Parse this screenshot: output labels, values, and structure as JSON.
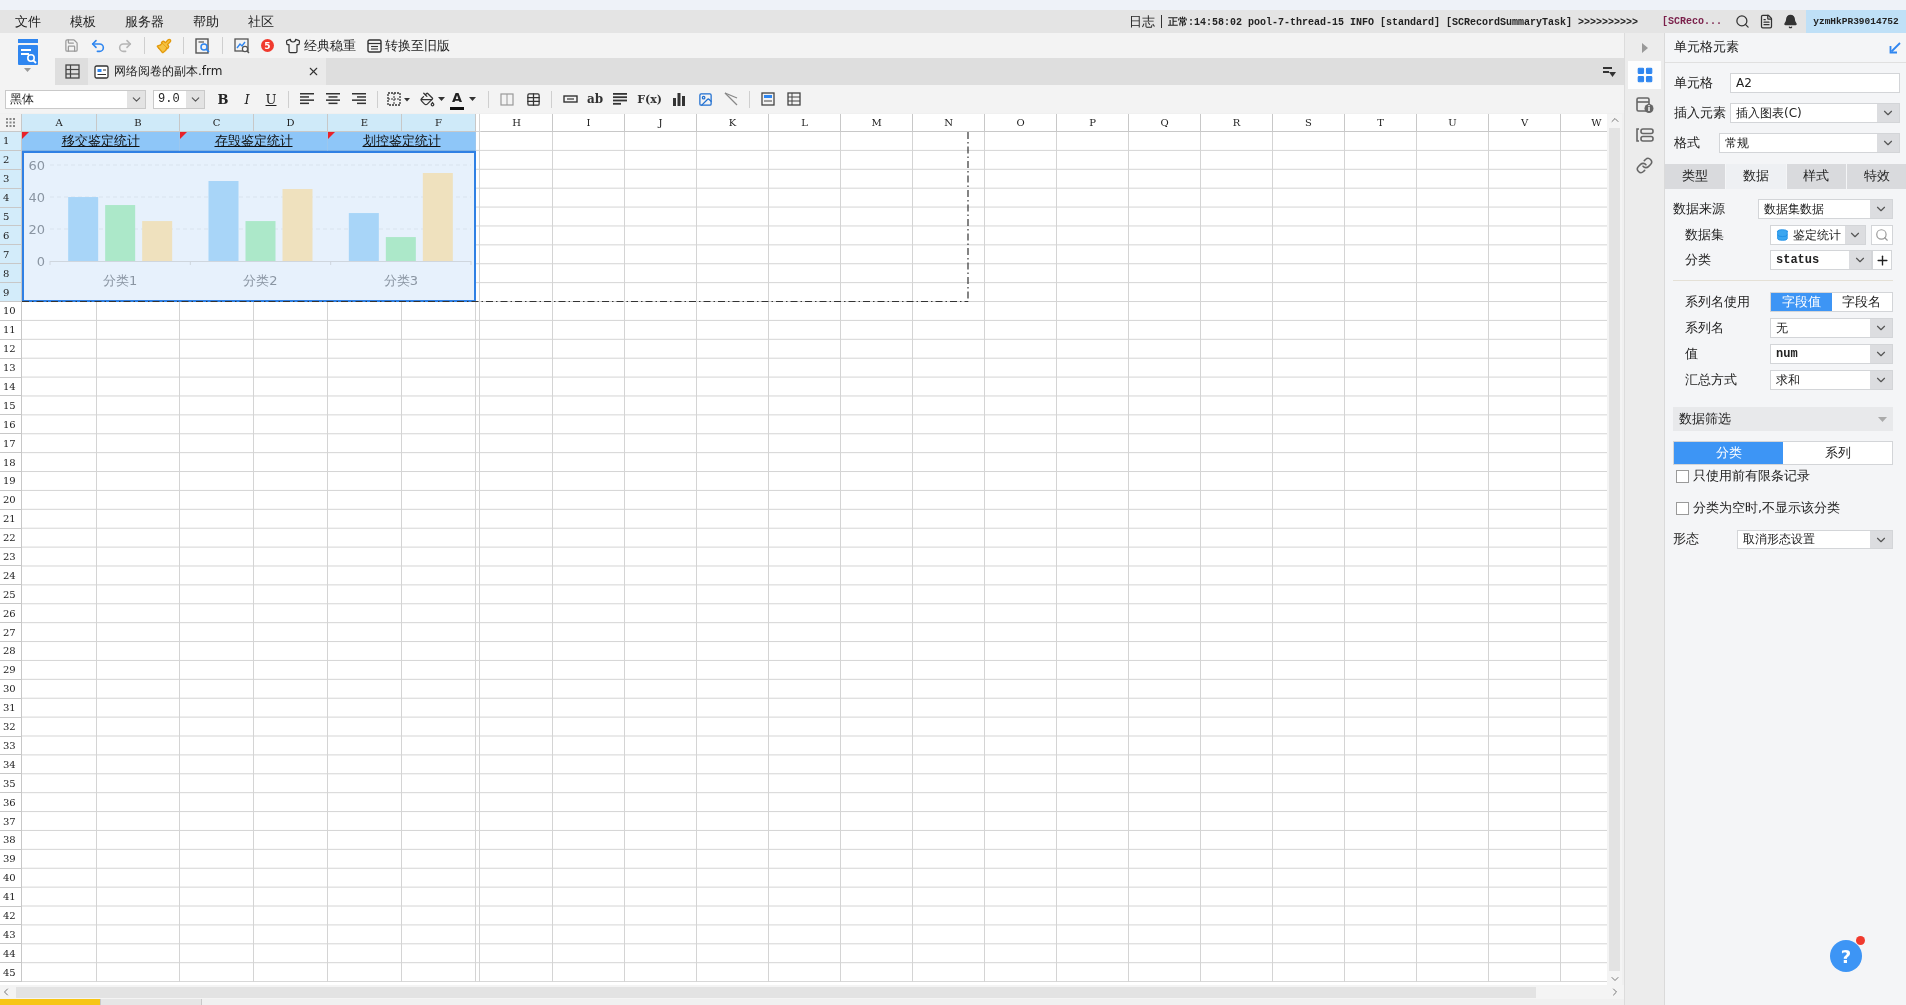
{
  "menu_bar": {
    "items": [
      "文件",
      "模板",
      "服务器",
      "帮助",
      "社区"
    ],
    "log_label": "日志",
    "log_message": "正常:14:58:02 pool-7-thread-15 INFO [standard] [SCRecordSummaryTask] >>>>>>>>>>",
    "log_tail": "[SCReco...",
    "user": "yzmHkPR39014752"
  },
  "toolbar": {
    "badge": "5",
    "buttons": [
      "经典稳重",
      "转换至旧版"
    ]
  },
  "file_tab": {
    "label": "网络阅卷的副本.frm"
  },
  "format_bar": {
    "font": "黑体",
    "size": "9.0",
    "text_styles": [
      "B",
      "I",
      "U"
    ],
    "font_color": "A",
    "tool_labels": [
      "ab",
      "F(x)"
    ]
  },
  "sheet": {
    "columns": [
      {
        "label": "A",
        "selected": true
      },
      {
        "label": "B",
        "selected": true
      },
      {
        "label": "C",
        "selected": true
      },
      {
        "label": "D",
        "selected": true
      },
      {
        "label": "E",
        "selected": true
      },
      {
        "label": "F",
        "selected": true
      },
      {
        "label": "H",
        "selected": false
      },
      {
        "label": "I",
        "selected": false
      },
      {
        "label": "J",
        "selected": false
      },
      {
        "label": "K",
        "selected": false
      },
      {
        "label": "L",
        "selected": false
      },
      {
        "label": "M",
        "selected": false
      },
      {
        "label": "N",
        "selected": false
      },
      {
        "label": "O",
        "selected": false
      },
      {
        "label": "P",
        "selected": false
      },
      {
        "label": "Q",
        "selected": false
      },
      {
        "label": "R",
        "selected": false
      },
      {
        "label": "S",
        "selected": false
      },
      {
        "label": "T",
        "selected": false
      },
      {
        "label": "U",
        "selected": false
      },
      {
        "label": "V",
        "selected": false
      },
      {
        "label": "W",
        "selected": false
      }
    ],
    "rows": [
      {
        "label": "1",
        "selected": true
      },
      {
        "label": "2",
        "selected": true
      },
      {
        "label": "3",
        "selected": true
      },
      {
        "label": "4",
        "selected": true
      },
      {
        "label": "5",
        "selected": true
      },
      {
        "label": "6",
        "selected": true
      },
      {
        "label": "7",
        "selected": true
      },
      {
        "label": "8",
        "selected": true
      },
      {
        "label": "9",
        "selected": true
      },
      {
        "label": "10",
        "selected": false
      },
      {
        "label": "11",
        "selected": false
      },
      {
        "label": "12",
        "selected": false
      },
      {
        "label": "13",
        "selected": false
      },
      {
        "label": "14",
        "selected": false
      },
      {
        "label": "15",
        "selected": false
      },
      {
        "label": "16",
        "selected": false
      },
      {
        "label": "17",
        "selected": false
      },
      {
        "label": "18",
        "selected": false
      },
      {
        "label": "19",
        "selected": false
      },
      {
        "label": "20",
        "selected": false
      },
      {
        "label": "21",
        "selected": false
      },
      {
        "label": "22",
        "selected": false
      },
      {
        "label": "23",
        "selected": false
      },
      {
        "label": "24",
        "selected": false
      },
      {
        "label": "25",
        "selected": false
      },
      {
        "label": "26",
        "selected": false
      },
      {
        "label": "27",
        "selected": false
      },
      {
        "label": "28",
        "selected": false
      },
      {
        "label": "29",
        "selected": false
      },
      {
        "label": "30",
        "selected": false
      },
      {
        "label": "31",
        "selected": false
      },
      {
        "label": "32",
        "selected": false
      },
      {
        "label": "33",
        "selected": false
      },
      {
        "label": "34",
        "selected": false
      },
      {
        "label": "35",
        "selected": false
      },
      {
        "label": "36",
        "selected": false
      },
      {
        "label": "37",
        "selected": false
      },
      {
        "label": "38",
        "selected": false
      },
      {
        "label": "39",
        "selected": false
      },
      {
        "label": "40",
        "selected": false
      },
      {
        "label": "41",
        "selected": false
      },
      {
        "label": "42",
        "selected": false
      },
      {
        "label": "43",
        "selected": false
      },
      {
        "label": "44",
        "selected": false
      },
      {
        "label": "45",
        "selected": false
      }
    ],
    "titles": [
      "移交鉴定统计",
      "存毁鉴定统计",
      "划控鉴定统计"
    ],
    "chart_data": {
      "type": "bar",
      "categories": [
        "分类1",
        "分类2",
        "分类3"
      ],
      "series": [
        {
          "color": "#a8d5f8",
          "values": [
            40,
            50,
            30
          ]
        },
        {
          "color": "#ace8c9",
          "values": [
            35,
            25,
            15
          ]
        },
        {
          "color": "#efe1be",
          "values": [
            25,
            45,
            55
          ]
        }
      ],
      "ylim": [
        0,
        60
      ],
      "yticks": [
        0,
        20,
        40,
        60
      ]
    }
  },
  "side_tabs": [
    {
      "kind": "cell",
      "selected": true
    },
    {
      "kind": "attributes",
      "selected": false
    },
    {
      "kind": "widget",
      "selected": false
    },
    {
      "kind": "link",
      "selected": false
    }
  ],
  "panel": {
    "title": "单元格元素",
    "fields": [
      {
        "kind": "input",
        "label": "单元格",
        "value": "A2"
      },
      {
        "kind": "select",
        "label": "插入元素",
        "value": "插入图表(C)"
      },
      {
        "kind": "select",
        "label": "格式",
        "value": "常规"
      }
    ],
    "tabs": [
      {
        "label": "类型",
        "selected": false
      },
      {
        "label": "数据",
        "selected": true
      },
      {
        "label": "样式",
        "selected": false
      },
      {
        "label": "特效",
        "selected": false
      }
    ],
    "data_source": {
      "label": "数据来源",
      "value": "数据集数据"
    },
    "dataset": {
      "label": "数据集",
      "value": "鉴定统计"
    },
    "category": {
      "label": "分类",
      "value": "status"
    },
    "series_name_use": {
      "label": "系列名使用",
      "options": [
        {
          "label": "字段值",
          "selected": true
        },
        {
          "label": "字段名",
          "selected": false
        }
      ]
    },
    "series_fields": [
      {
        "label": "系列名",
        "value": "无"
      },
      {
        "label": "值",
        "value": "num"
      },
      {
        "label": "汇总方式",
        "value": "求和"
      }
    ],
    "filter": {
      "title": "数据筛选",
      "options": [
        {
          "label": "分类",
          "selected": true
        },
        {
          "label": "系列",
          "selected": false
        }
      ],
      "checkboxes": [
        {
          "label": "只使用前有限条记录",
          "checked": false
        },
        {
          "label": "分类为空时,不显示该分类",
          "checked": false
        }
      ]
    },
    "form": {
      "label": "形态",
      "value": "取消形态设置"
    }
  },
  "help": {
    "label": "?"
  }
}
